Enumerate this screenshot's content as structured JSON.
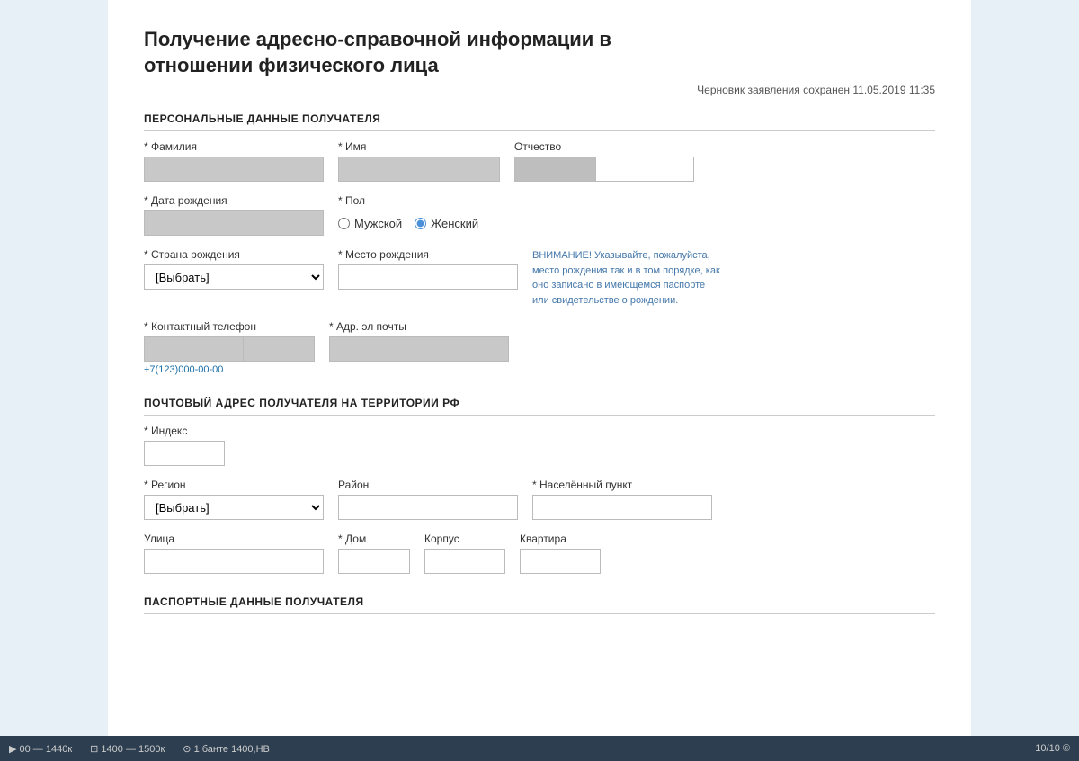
{
  "page": {
    "title_line1": "Получение адресно-справочной информации в",
    "title_line2": "отношении физического лица",
    "draft_saved": "Черновик заявления сохранен 11.05.2019 11:35"
  },
  "sections": {
    "personal": {
      "title": "ПЕРСОНАЛЬНЫЕ ДАННЫЕ ПОЛУЧАТЕЛЯ",
      "fields": {
        "last_name_label": "* Фамилия",
        "first_name_label": "* Имя",
        "patronymic_label": "Отчество",
        "birth_date_label": "* Дата рождения",
        "gender_label": "* Пол",
        "gender_male": "Мужской",
        "gender_female": "Женский",
        "birth_country_label": "* Страна рождения",
        "birth_country_placeholder": "[Выбрать]",
        "birth_place_label": "* Место рождения",
        "phone_label": "* Контактный телефон",
        "phone_hint": "+7(123)000-00-00",
        "email_label": "* Адр. эл почты",
        "notice": "ВНИМАНИЕ! Указывайте, пожалуйста, место рождения так и в том порядке, как оно записано в имеющемся паспорте или свидетельстве о рождении."
      }
    },
    "address": {
      "title": "ПОЧТОВЫЙ АДРЕС ПОЛУЧАТЕЛЯ НА ТЕРРИТОРИИ РФ",
      "fields": {
        "index_label": "* Индекс",
        "region_label": "* Регион",
        "region_placeholder": "[Выбрать]",
        "district_label": "Район",
        "settlement_label": "* Населённый пункт",
        "street_label": "Улица",
        "house_label": "* Дом",
        "building_label": "Корпус",
        "apartment_label": "Квартира"
      }
    },
    "passport": {
      "title": "ПАСПОРТНЫЕ ДАННЫЕ ПОЛУЧАТЕЛЯ"
    }
  },
  "bottombar": {
    "item1": "▶ 00 — 1440к",
    "item2": "⊡ 1400 — 1500к",
    "item3": "⊙ 1 банте 1400,НВ",
    "item4": "10/10 ©"
  }
}
